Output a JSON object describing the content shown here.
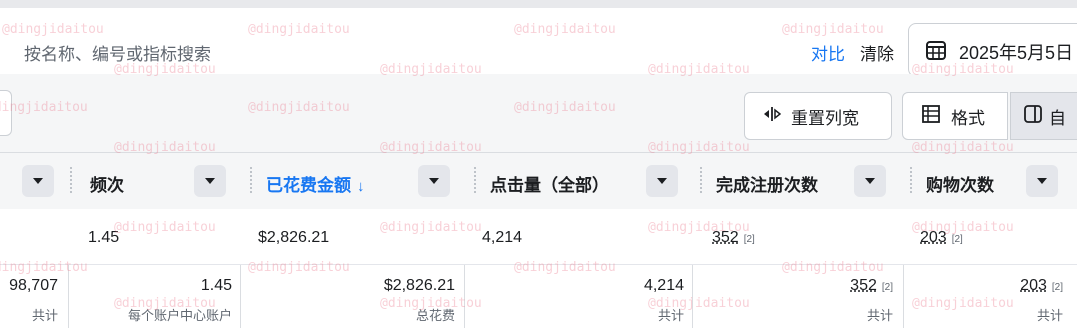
{
  "search": {
    "placeholder": "按名称、编号或指标搜索"
  },
  "header_actions": {
    "compare": "对比",
    "clear": "清除"
  },
  "date_picker": {
    "label": "2025年5月5日",
    "icon": "calendar-icon"
  },
  "toolbar": {
    "reset_columns": "重置列宽",
    "format": "格式",
    "custom": "自",
    "icons": {
      "reset": "column-resize-icon",
      "format": "format-icon",
      "custom": "panel-icon"
    }
  },
  "columns": [
    {
      "label": "",
      "sorted": false
    },
    {
      "label": "频次",
      "sorted": false
    },
    {
      "label": "已花费金额",
      "sorted": true,
      "sort_icon": "↓"
    },
    {
      "label": "点击量（全部）",
      "sorted": false
    },
    {
      "label": "完成注册次数",
      "sorted": false
    },
    {
      "label": "购物次数",
      "sorted": false
    }
  ],
  "row": {
    "frequency": "1.45",
    "spend": "$2,826.21",
    "clicks": "4,214",
    "registrations": "352",
    "registrations_note": "[2]",
    "purchases": "203",
    "purchases_note": "[2]"
  },
  "totals": {
    "first": {
      "value": "98,707",
      "sub": "共计"
    },
    "frequency": {
      "value": "1.45",
      "sub": "每个账户中心账户"
    },
    "spend": {
      "value": "$2,826.21",
      "sub": "总花费"
    },
    "clicks": {
      "value": "4,214",
      "sub": "共计"
    },
    "registrations": {
      "value": "352",
      "note": "[2]",
      "sub": "共计"
    },
    "purchases": {
      "value": "203",
      "note": "[2]",
      "sub": "共计"
    }
  },
  "watermark": "@dingjidaitou",
  "colors": {
    "accent": "#1877f2",
    "header_bg": "#f5f6f7",
    "border": "#dadde1"
  }
}
